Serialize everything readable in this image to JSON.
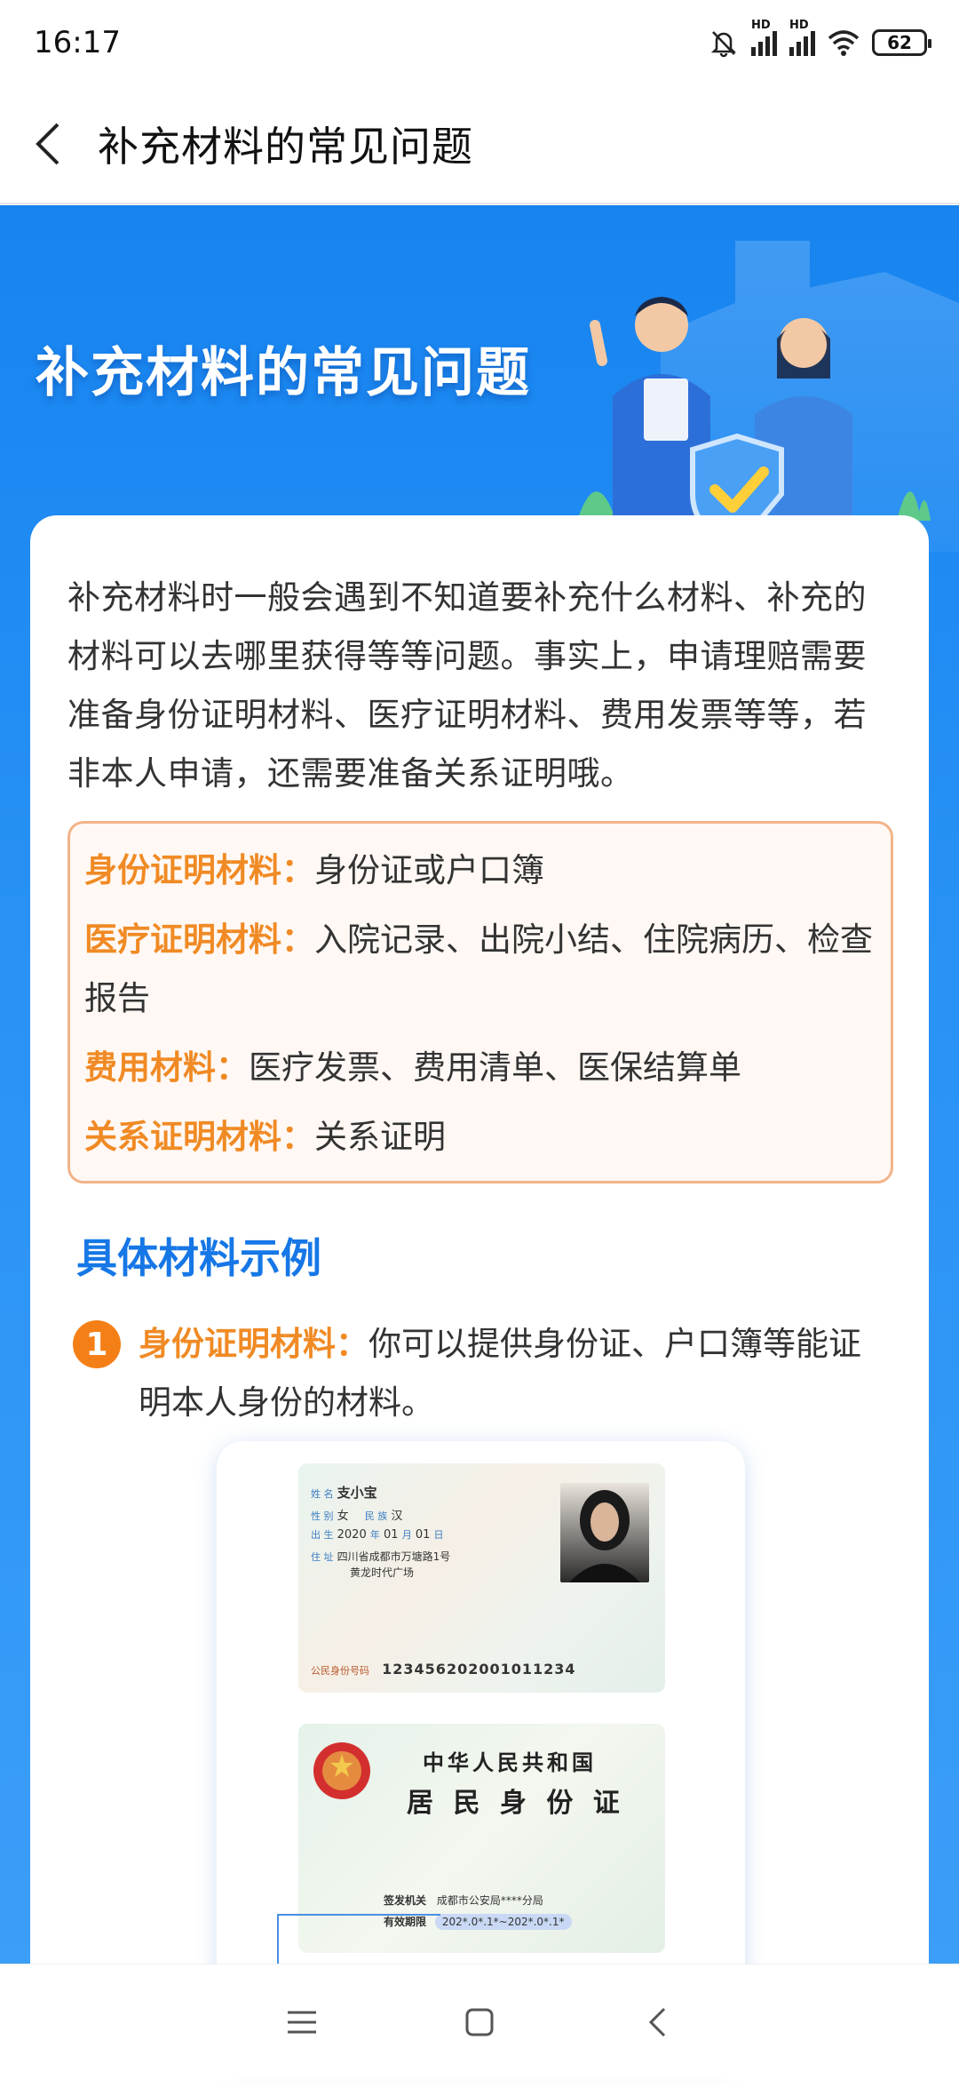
{
  "status": {
    "time": "16:17",
    "battery": "62",
    "hd_label": "HD"
  },
  "header": {
    "title": "补充材料的常见问题"
  },
  "banner": {
    "title": "补充材料的常见问题"
  },
  "content": {
    "intro": "补充材料时一般会遇到不知道要补充什么材料、补充的材料可以去哪里获得等等问题。事实上，申请理赔需要准备身份证明材料、医疗证明材料、费用发票等等，若非本人申请，还需要准备关系证明哦。",
    "materials": [
      {
        "key": "身份证明材料：",
        "value": "身份证或户口簿"
      },
      {
        "key": "医疗证明材料：",
        "value": "入院记录、出院小结、住院病历、检查报告"
      },
      {
        "key": "费用材料：",
        "value": "医疗发票、费用清单、医保结算单"
      },
      {
        "key": "关系证明材料：",
        "value": "关系证明"
      }
    ],
    "section_title": "具体材料示例",
    "examples": [
      {
        "num": "1",
        "key": "身份证明材料：",
        "value": "你可以提供身份证、户口簿等能证明本人身份的材料。"
      }
    ]
  },
  "id_front": {
    "name_label": "姓 名",
    "name": "支小宝",
    "sex_label": "性 别",
    "sex": "女",
    "nation_label": "民 族",
    "nation": "汉",
    "birth_label": "出 生",
    "birth_year": "2020",
    "birth_year_unit": "年",
    "birth_month": "01",
    "birth_month_unit": "月",
    "birth_day": "01",
    "birth_day_unit": "日",
    "addr_label": "住 址",
    "addr1": "四川省成都市万塘路1号",
    "addr2": "黄龙时代广场",
    "idnum_label": "公民身份号码",
    "idnum": "123456202001011234"
  },
  "id_back": {
    "country": "中华人民共和国",
    "card_name": "居 民 身 份 证",
    "issuer_label": "签发机关",
    "issuer": "成都市公安局****分局",
    "valid_label": "有效期限",
    "valid": "202*.0*.1*~202*.0*.1*"
  },
  "colors": {
    "accent_blue": "#1677e6",
    "accent_orange": "#f08a24",
    "banner_blue": "#1784f0"
  }
}
